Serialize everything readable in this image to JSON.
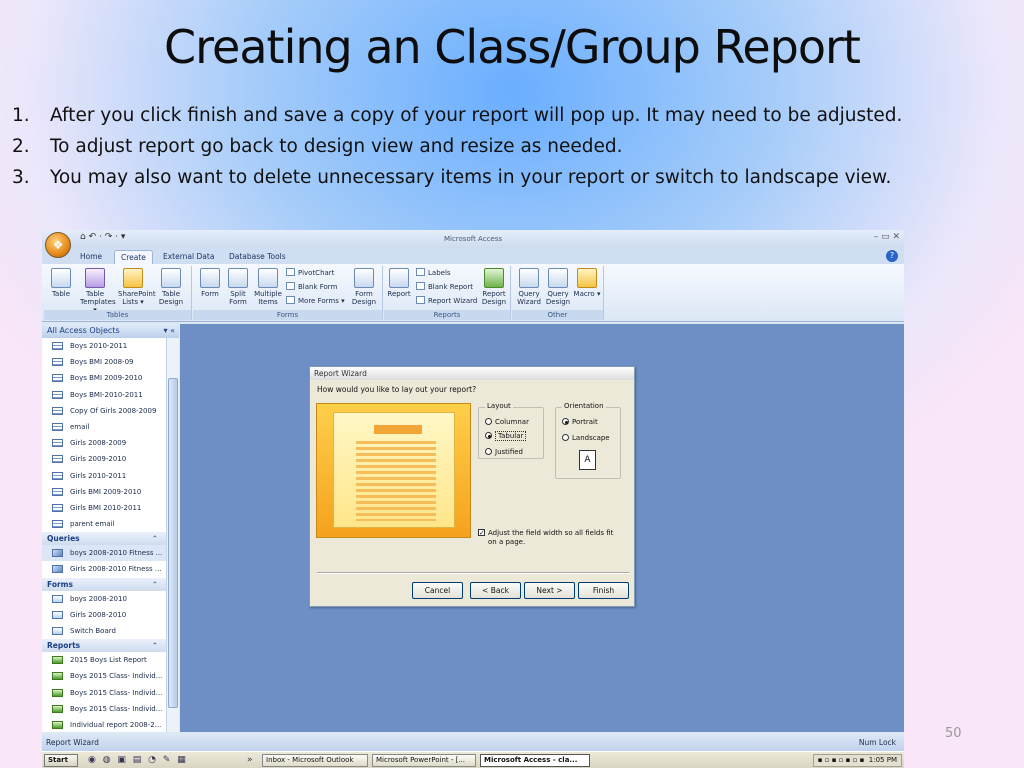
{
  "slide": {
    "title": "Creating an Class/Group Report",
    "page_number": "50",
    "points": [
      {
        "num": "1.",
        "text": "After you click finish and save a copy of your report will pop up.  It may need to be adjusted."
      },
      {
        "num": "2.",
        "text": "To adjust report go back to design view and resize as needed."
      },
      {
        "num": "3.",
        "text": "You may also want to delete unnecessary items in your report or switch to landscape view."
      }
    ]
  },
  "window": {
    "title": "Microsoft Access",
    "controls": "– ▭ ✕",
    "qat": "⌂ ↶ · ↷ · ▾",
    "tabs": [
      "Home",
      "Create",
      "External Data",
      "Database Tools"
    ],
    "active_tab": "Create"
  },
  "ribbon": {
    "tables": {
      "label": "Tables",
      "buttons": [
        "Table",
        "Table Templates ▾",
        "SharePoint Lists ▾",
        "Table Design"
      ]
    },
    "forms": {
      "label": "Forms",
      "buttons": [
        "Form",
        "Split Form",
        "Multiple Items"
      ],
      "small": [
        "PivotChart",
        "Blank Form",
        "More Forms ▾"
      ],
      "design": "Form Design"
    },
    "reports": {
      "label": "Reports",
      "report": "Report",
      "small": [
        "Labels",
        "Blank Report",
        "Report Wizard"
      ],
      "design": "Report Design"
    },
    "other": {
      "label": "Other",
      "buttons": [
        "Query Wizard",
        "Query Design",
        "Macro ▾"
      ]
    }
  },
  "nav": {
    "header": "All Access Objects",
    "header_icons": "▾ «",
    "tables": [
      "Boys 2010-2011",
      "Boys BMI 2008-09",
      "Boys BMI 2009-2010",
      "Boys BMI-2010-2011",
      "Copy Of Girls 2008-2009",
      "email",
      "Girls 2008-2009",
      "Girls 2009-2010",
      "Girls 2010-2011",
      "Girls BMI 2009-2010",
      "Girls BMI 2010-2011",
      "parent email"
    ],
    "queries_label": "Queries",
    "queries": [
      "boys 2008-2010 Fitness ...",
      "Girls 2008-2010 Fitness ..."
    ],
    "forms_label": "Forms",
    "forms": [
      "boys 2008-2010",
      "Girls 2008-2010",
      "Switch Board"
    ],
    "reports_label": "Reports",
    "reports": [
      "2015 Boys List Report",
      "Boys 2015 Class- Individ...",
      "Boys 2015 Class- Individ...",
      "Boys 2015 Class- Individ...",
      "Individual report 2008-2..."
    ],
    "collapse_icon": "⌃"
  },
  "dialog": {
    "title": "Report Wizard",
    "question": "How would you like to lay out your report?",
    "layout_label": "Layout",
    "layout_options": [
      "Columnar",
      "Tabular",
      "Justified"
    ],
    "layout_selected": "Tabular",
    "orientation_label": "Orientation",
    "orientation_options": [
      "Portrait",
      "Landscape"
    ],
    "orientation_selected": "Portrait",
    "orientation_glyph": "A",
    "checkbox_label": "Adjust the field width so all fields fit on a page.",
    "checkbox_checked": true,
    "buttons": {
      "cancel": "Cancel",
      "back": "< Back",
      "next": "Next >",
      "finish": "Finish"
    }
  },
  "status": {
    "left": "Report Wizard",
    "right": "Num Lock"
  },
  "taskbar": {
    "start": "Start",
    "quicklaunch": "◉ ◍ ▣ ▤ ◔ ✎ ▦",
    "overflow": "»",
    "buttons": [
      "Inbox - Microsoft Outlook",
      "Microsoft PowerPoint - [...",
      "Microsoft Access - cla..."
    ],
    "active": "Microsoft Access - cla...",
    "tray_icons": "▪ ▫ ▪ ▫ ▪ ▫ ▪",
    "clock": "1:05 PM"
  }
}
